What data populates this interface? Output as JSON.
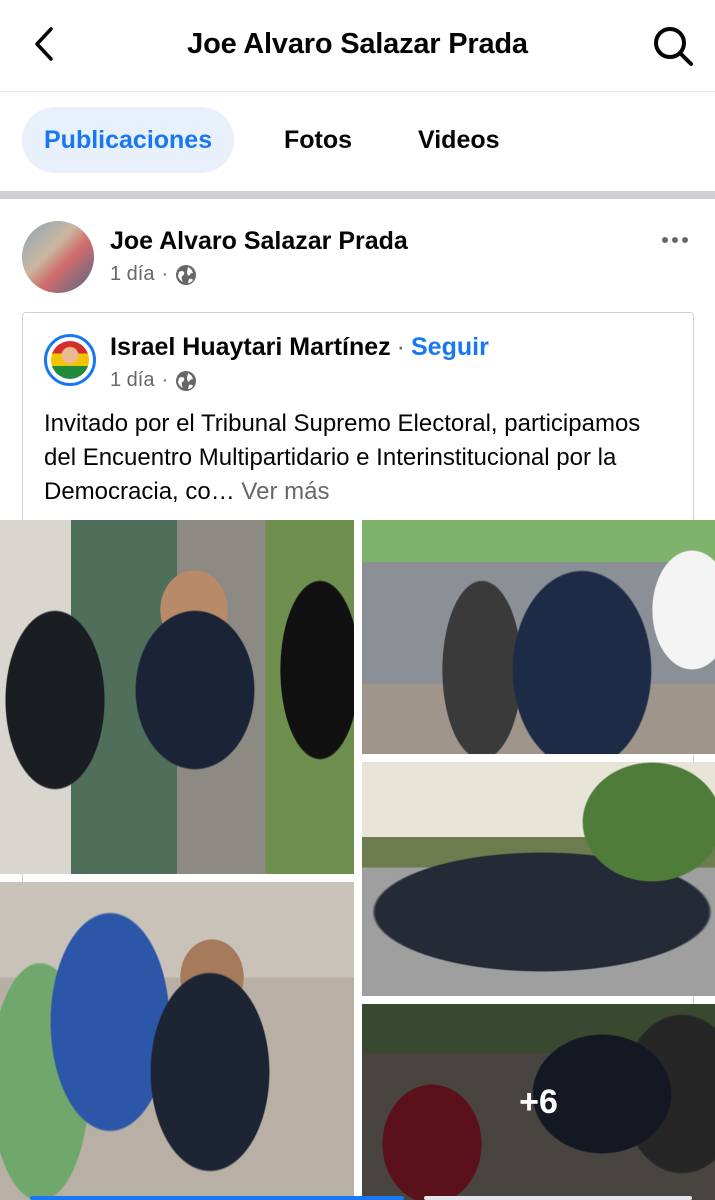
{
  "header": {
    "title": "Joe Alvaro Salazar Prada",
    "back_icon": "chevron-left-icon",
    "search_icon": "search-icon"
  },
  "tabs": [
    {
      "label": "Publicaciones",
      "active": true
    },
    {
      "label": "Fotos",
      "active": false
    },
    {
      "label": "Videos",
      "active": false
    }
  ],
  "post": {
    "author": "Joe Alvaro Salazar Prada",
    "time": "1 día",
    "separator": "·",
    "audience_icon": "globe-icon",
    "more_icon": "more-horizontal-icon",
    "shared": {
      "author": "Israel Huaytari Martínez",
      "separator": "·",
      "follow_label": "Seguir",
      "time": "1 día",
      "audience_icon": "globe-icon",
      "text": "Invitado por el Tribunal Supremo Electoral, participamos del Encuentro Multipartidario e Interinstitucional por la Democracia, co…",
      "see_more": "Ver más"
    },
    "photos": {
      "count_visible": 5,
      "more_count": "+6"
    }
  },
  "colors": {
    "accent": "#1877f2",
    "tab_active_bg": "#e7f0fb",
    "secondary_text": "#65676b",
    "divider": "#ced0d4"
  }
}
